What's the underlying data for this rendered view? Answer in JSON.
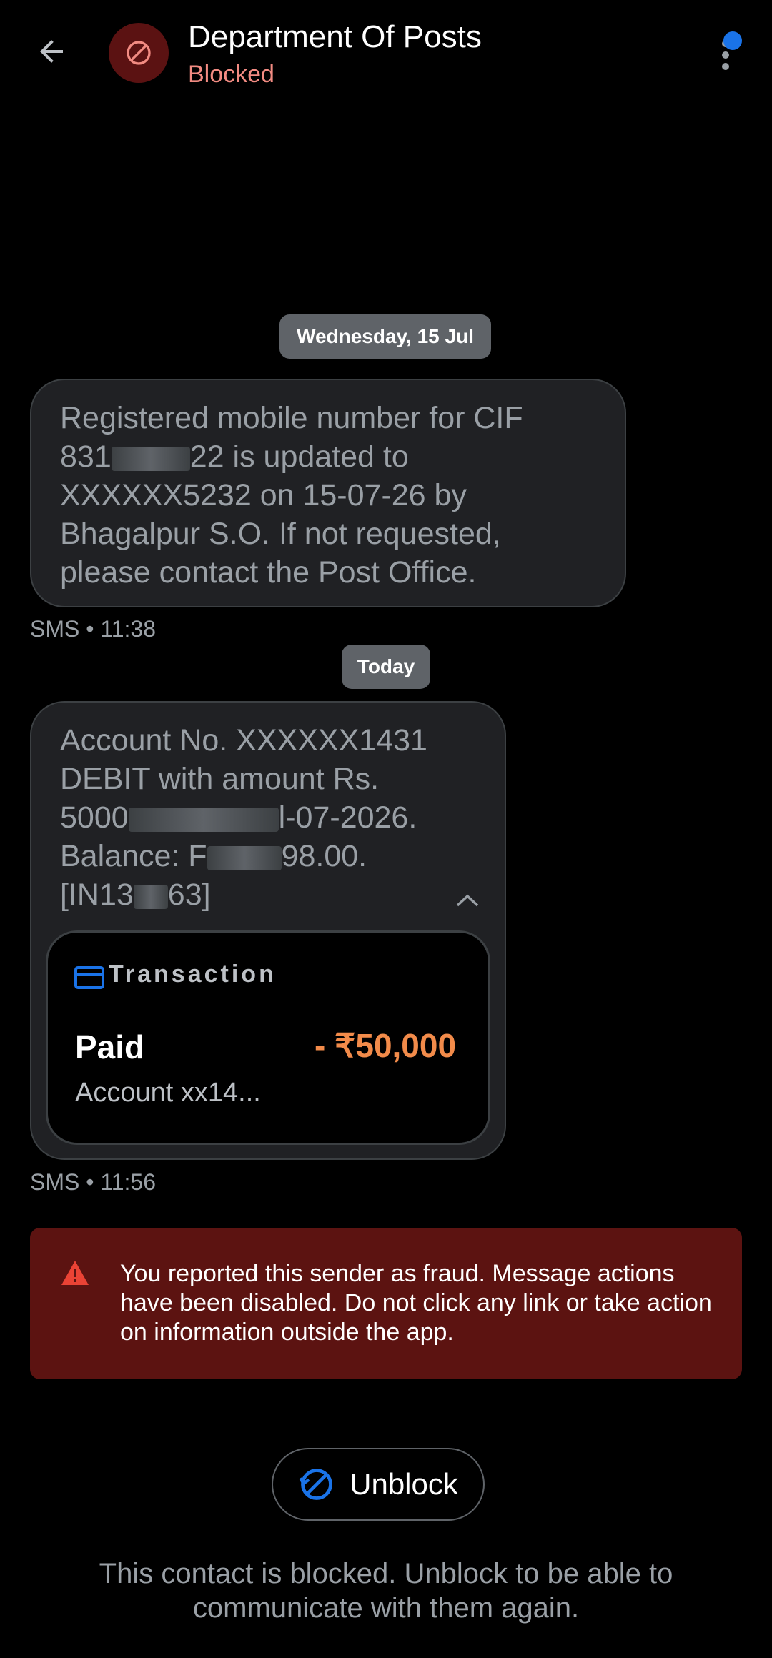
{
  "header": {
    "title": "Department Of Posts",
    "subtitle": "Blocked"
  },
  "messages": [
    {
      "date_chip": "Wednesday, 15 Jul",
      "lines": [
        "Registered mobile number for CIF",
        "831",
        "22 is updated to",
        "XXXXXX5232 on 15-07-26 by",
        "Bhagalpur S.O. If not requested,",
        "please contact the Post Office."
      ],
      "meta": "SMS • 11:38"
    },
    {
      "date_chip": "Today",
      "lines": [
        "Account  No. XXXXXX1431",
        "DEBIT with amount Rs.",
        "5000",
        "l-07-2026.",
        "Balance: F",
        "98.00.",
        "[IN13",
        "63]"
      ],
      "meta": "SMS • 11:56"
    }
  ],
  "transaction": {
    "label": "Transaction",
    "status": "Paid",
    "amount": "- ₹50,000",
    "account": "Account xx14..."
  },
  "fraud_banner": {
    "text": "You reported this sender as fraud. Message actions have been disabled. Do not click any link or take action on information outside the app."
  },
  "unblock": {
    "label": "Unblock"
  },
  "blocked_note": "This contact is blocked. Unblock to be able to communicate with them again.",
  "colors": {
    "accent": "#1a73e8",
    "blocked_red": "#f28b82",
    "amount_orange": "#f28b4a",
    "banner_bg": "#5c1311"
  }
}
